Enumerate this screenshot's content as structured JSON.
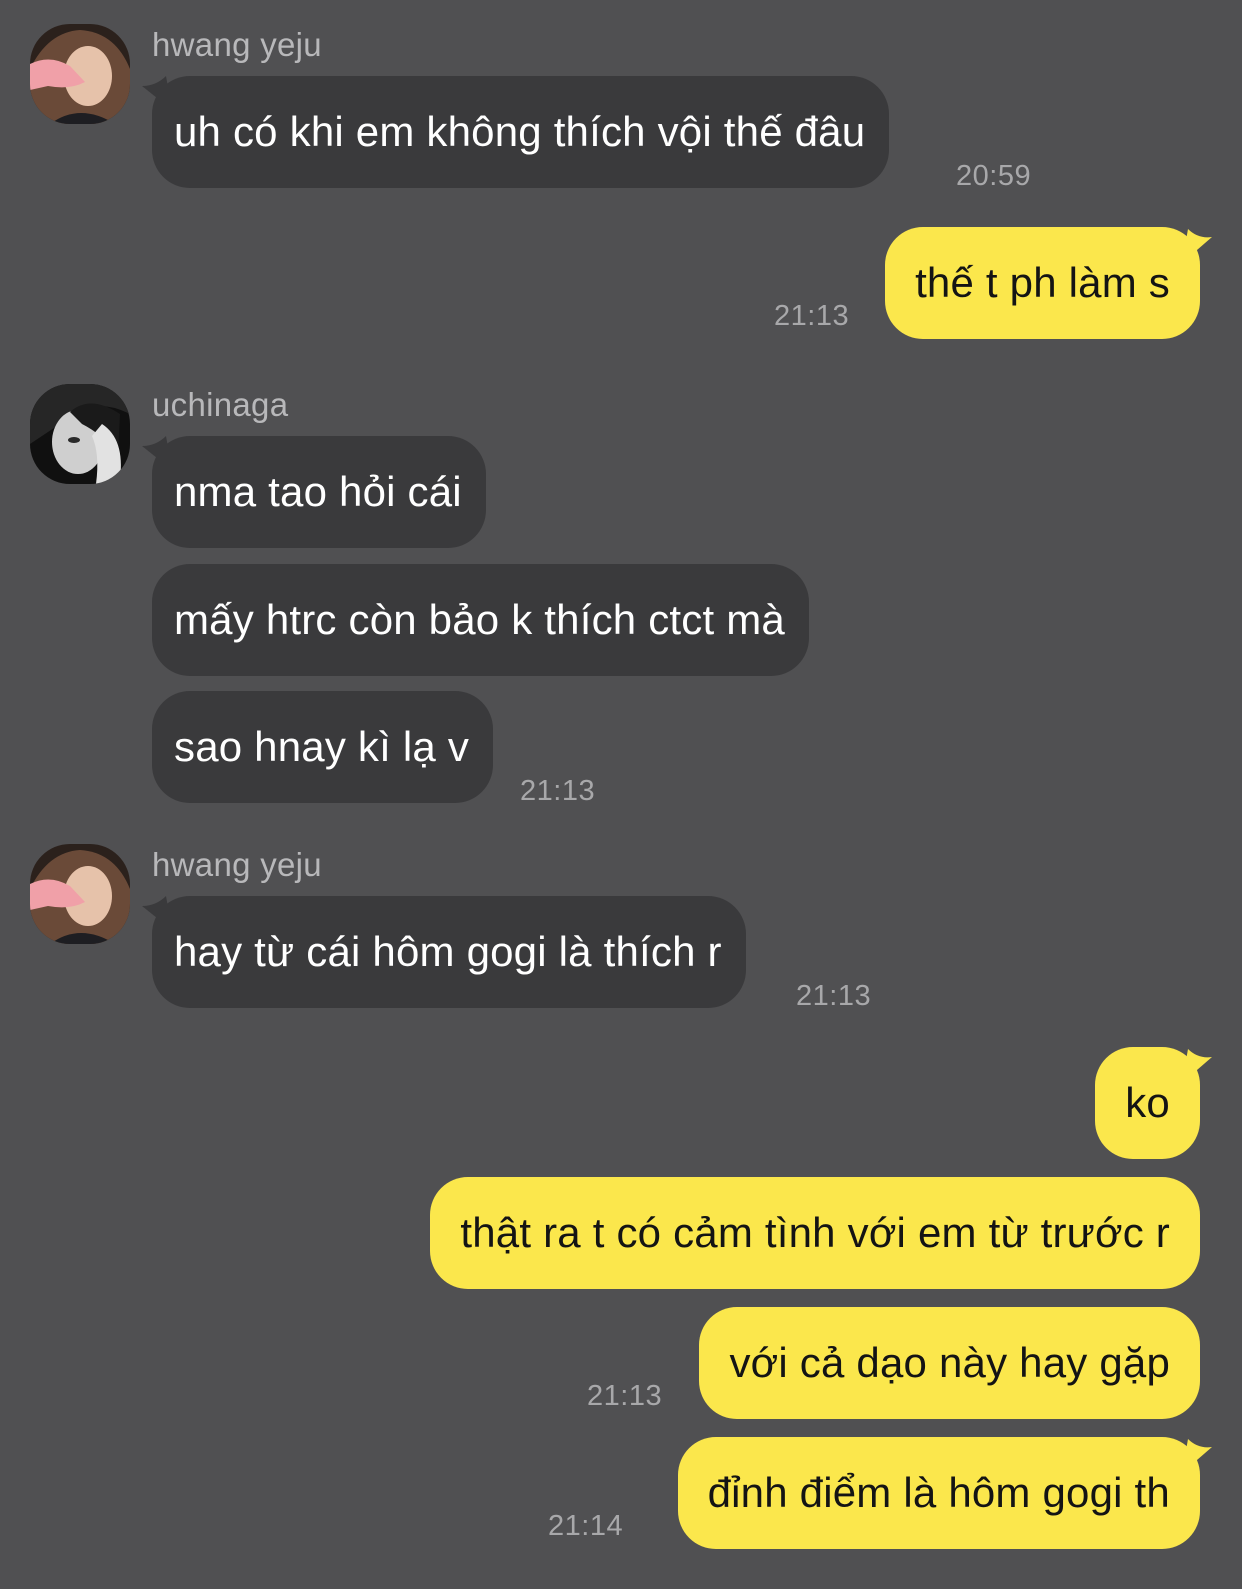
{
  "chat": {
    "colors": {
      "background": "#505052",
      "incoming_bubble": "#3a3a3c",
      "outgoing_bubble": "#fbe74c",
      "timestamp": "#a8a8aa",
      "sender_name": "#b8b8ba"
    },
    "groups": [
      {
        "sender": "hwang yeju",
        "avatar_icon": "profile-photo-icon",
        "messages": [
          "uh có khi em không thích vội thế đâu"
        ],
        "time": "20:59"
      },
      {
        "sender": "me",
        "messages": [
          "thế t ph làm s"
        ],
        "time": "21:13"
      },
      {
        "sender": "uchinaga",
        "avatar_icon": "profile-photo-icon",
        "messages": [
          "nma tao hỏi cái",
          "mấy htrc còn bảo k thích ctct mà",
          "sao hnay kì lạ v"
        ],
        "time": "21:13"
      },
      {
        "sender": "hwang yeju",
        "avatar_icon": "profile-photo-icon",
        "messages": [
          "hay từ cái hôm gogi là thích r"
        ],
        "time": "21:13"
      },
      {
        "sender": "me",
        "messages": [
          "ko",
          "thật ra t có cảm tình với em từ trước r",
          "với cả dạo này hay gặp"
        ],
        "time": "21:13"
      },
      {
        "sender": "me",
        "messages": [
          "đỉnh điểm là hôm gogi th"
        ],
        "time": "21:14"
      }
    ]
  }
}
